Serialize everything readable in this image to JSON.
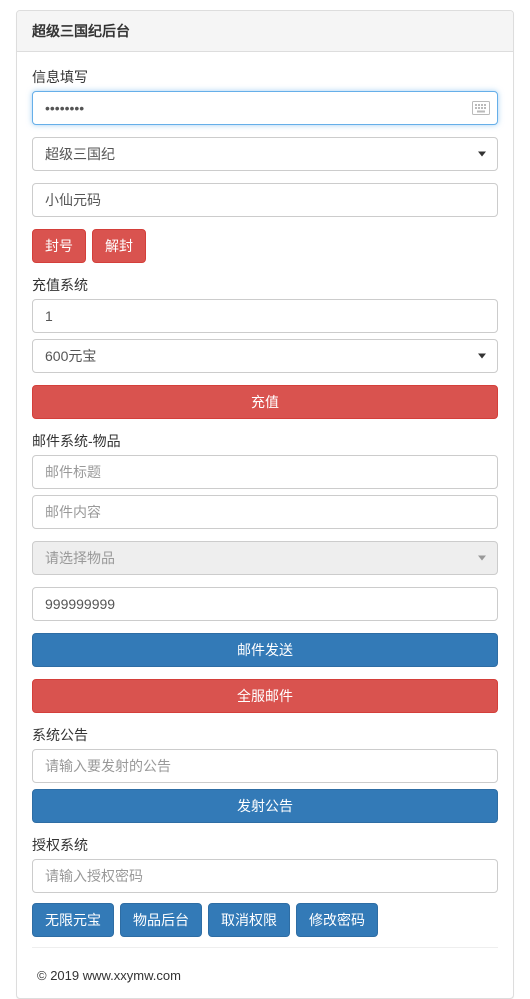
{
  "panel": {
    "title": "超级三国纪后台"
  },
  "info": {
    "label": "信息填写",
    "password_value": "••••••••",
    "server_selected": "超级三国纪",
    "nickname_value": "小仙元码",
    "ban_label": "封号",
    "unban_label": "解封"
  },
  "recharge": {
    "label": "充值系统",
    "amount_value": "1",
    "option_selected": "600元宝",
    "submit_label": "充值"
  },
  "mail": {
    "label": "邮件系统-物品",
    "title_placeholder": "邮件标题",
    "content_placeholder": "邮件内容",
    "item_placeholder": "请选择物品",
    "quantity_value": "999999999",
    "send_label": "邮件发送",
    "broadcast_label": "全服邮件"
  },
  "announce": {
    "label": "系统公告",
    "input_placeholder": "请输入要发射的公告",
    "submit_label": "发射公告"
  },
  "auth": {
    "label": "授权系统",
    "input_placeholder": "请输入授权密码",
    "btn_unlimited": "无限元宝",
    "btn_item_admin": "物品后台",
    "btn_revoke": "取消权限",
    "btn_change_pw": "修改密码"
  },
  "footer": {
    "copyright": "© 2019 www.xxymw.com"
  }
}
